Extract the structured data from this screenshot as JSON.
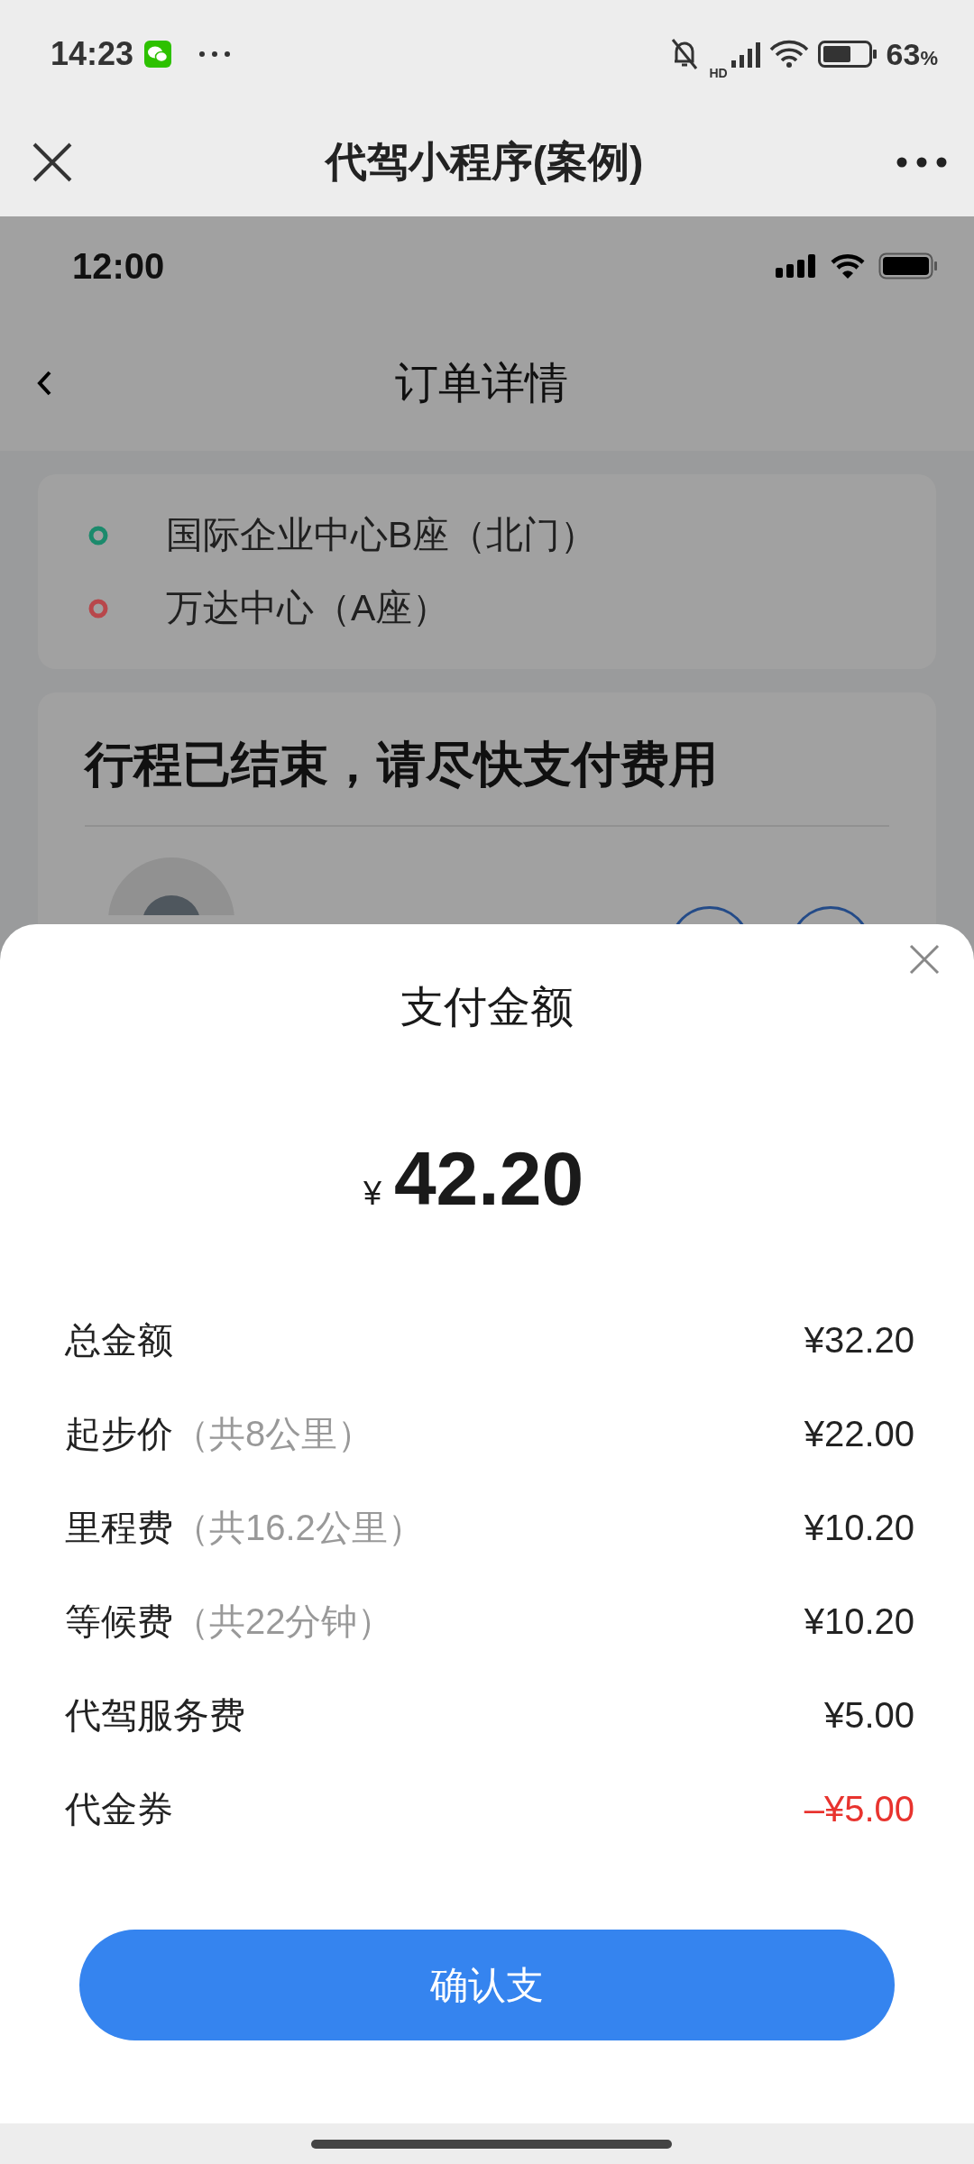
{
  "status_bar": {
    "time": "14:23",
    "network": "HD",
    "battery": "63",
    "battery_unit": "%"
  },
  "mini_nav": {
    "title": "代驾小程序(案例)"
  },
  "page": {
    "status_time": "12:00",
    "title": "订单详情",
    "route": [
      {
        "name": "国际企业中心B座（北门）",
        "color": "#1b8a6c"
      },
      {
        "name": "万达中心（A座）",
        "color": "#b8474b"
      }
    ],
    "trip_message": "行程已结束，请尽快支付费用"
  },
  "sheet": {
    "title": "支付金额",
    "currency": "¥",
    "amount": "42.20",
    "rows": [
      {
        "kind": "charge",
        "label": "总金额",
        "amount": "¥32.20"
      },
      {
        "kind": "charge",
        "label": "起步价",
        "note": "（共8公里）",
        "amount": "¥22.00"
      },
      {
        "kind": "charge",
        "label": "里程费",
        "note": "（共16.2公里）",
        "amount": "¥10.20"
      },
      {
        "kind": "charge",
        "label": "等候费",
        "note": "（共22分钟）",
        "amount": "¥10.20"
      },
      {
        "kind": "charge",
        "label": "代驾服务费",
        "amount": "¥5.00"
      },
      {
        "kind": "discount",
        "label": "代金券",
        "amount": "–¥5.00"
      }
    ],
    "button": "确认支"
  }
}
